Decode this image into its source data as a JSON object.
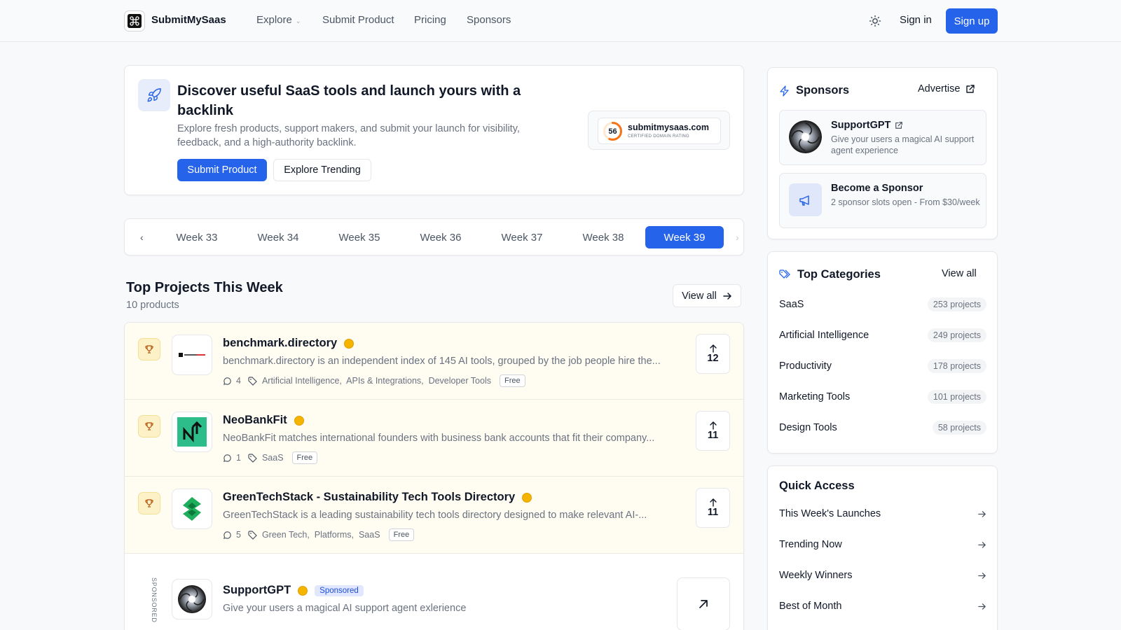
{
  "header": {
    "brand": "SubmitMySaas",
    "nav": [
      {
        "label": "Explore",
        "has_dropdown": true
      },
      {
        "label": "Submit Product"
      },
      {
        "label": "Pricing"
      },
      {
        "label": "Sponsors"
      }
    ],
    "sign_in": "Sign in",
    "sign_up": "Sign up",
    "theme_icon": "sun-icon"
  },
  "hero": {
    "title": "Discover useful SaaS tools and launch yours with a backlink",
    "subtitle": "Explore fresh products, support makers, and submit your launch for visibility, feedback, and a high-authority backlink.",
    "primary_button": "Submit Product",
    "secondary_button": "Explore Trending",
    "badge": {
      "rating": "56",
      "rating_value": 56,
      "domain": "submitmysaas.com",
      "label": "CERTIFIED DOMAIN RATING"
    }
  },
  "weeks": {
    "items": [
      "Week 33",
      "Week 34",
      "Week 35",
      "Week 36",
      "Week 37",
      "Week 38",
      "Week 39"
    ],
    "active": "Week 39"
  },
  "top_projects": {
    "title": "Top Projects This Week",
    "count": "10 products",
    "view_all": "View all",
    "items": [
      {
        "name": "benchmark.directory",
        "description": "benchmark.directory is an independent index of 145 AI tools, grouped by the job people hire the...",
        "comments": "4",
        "categories": "Artificial Intelligence,  APIs & Integrations,  Developer Tools",
        "pricing": "Free",
        "upvotes": "12"
      },
      {
        "name": "NeoBankFit",
        "description": "NeoBankFit matches international founders with business bank accounts that fit their company...",
        "comments": "1",
        "categories": "SaaS",
        "pricing": "Free",
        "upvotes": "11"
      },
      {
        "name": "GreenTechStack - Sustainability Tech Tools Directory",
        "description": "GreenTechStack is a leading sustainability tech tools directory designed to make relevant AI-...",
        "comments": "5",
        "categories": "Green Tech,  Platforms,  SaaS",
        "pricing": "Free",
        "upvotes": "11"
      }
    ],
    "sponsored": {
      "vertical_label": "SPONSORED",
      "name": "SupportGPT",
      "tag": "Sponsored",
      "description": "Give your users a magical AI support agent exlerience"
    }
  },
  "sidebar": {
    "sponsors": {
      "title": "Sponsors",
      "advertise": "Advertise",
      "items": [
        {
          "name": "SupportGPT",
          "description": "Give your users a magical AI support agent experience"
        },
        {
          "name": "Become a Sponsor",
          "description": "2 sponsor slots open - From $30/week"
        }
      ]
    },
    "categories": {
      "title": "Top Categories",
      "view_all": "View all",
      "items": [
        {
          "name": "SaaS",
          "count": "253 projects"
        },
        {
          "name": "Artificial Intelligence",
          "count": "249 projects"
        },
        {
          "name": "Productivity",
          "count": "178 projects"
        },
        {
          "name": "Marketing Tools",
          "count": "101 projects"
        },
        {
          "name": "Design Tools",
          "count": "58 projects"
        }
      ]
    },
    "quick_access": {
      "title": "Quick Access",
      "items": [
        "This Week's Launches",
        "Trending Now",
        "Weekly Winners",
        "Best of Month"
      ]
    }
  },
  "colors": {
    "accent": "#2563eb",
    "highlight_row": "#fffdf2",
    "gold": "#f5b400"
  }
}
